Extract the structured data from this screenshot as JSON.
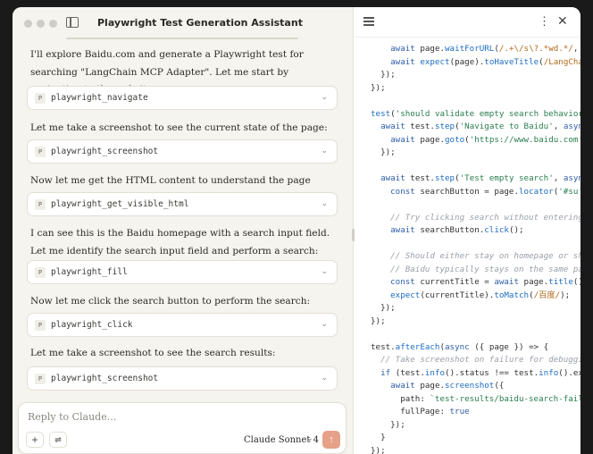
{
  "window": {
    "title": "Playwright Test Generation Assistant"
  },
  "messages": [
    {
      "text": "I'll explore Baidu.com and generate a Playwright test for searching \"LangChain MCP Adapter\". Let me start by navigating to the website."
    },
    {
      "tool": "playwright_navigate"
    },
    {
      "text": "Let me take a screenshot to see the current state of the page:"
    },
    {
      "tool": "playwright_screenshot"
    },
    {
      "text": "Now let me get the HTML content to understand the page structure:"
    },
    {
      "tool": "playwright_get_visible_html"
    },
    {
      "text": "I can see this is the Baidu homepage with a search input field. Let me identify the search input field and perform a search:"
    },
    {
      "tool": "playwright_fill"
    },
    {
      "text": "Now let me click the search button to perform the search:"
    },
    {
      "tool": "playwright_click"
    },
    {
      "text": "Let me take a screenshot to see the search results:"
    },
    {
      "tool": "playwright_screenshot"
    }
  ],
  "tool_badge": "P",
  "composer": {
    "placeholder": "Reply to Claude...",
    "model": "Claude Sonnet 4"
  },
  "code_lines": [
    [
      [
        "t-pl",
        "    "
      ],
      [
        "t-kw",
        "await"
      ],
      [
        "t-pl",
        " page."
      ],
      [
        "t-fn",
        "waitForURL"
      ],
      [
        "t-pl",
        "("
      ],
      [
        "t-rx",
        "/.+\\/s\\?.*wd.*/"
      ],
      [
        "t-pl",
        ", { t"
      ]
    ],
    [
      [
        "t-pl",
        "    "
      ],
      [
        "t-kw",
        "await"
      ],
      [
        "t-pl",
        " "
      ],
      [
        "t-fn",
        "expect"
      ],
      [
        "t-pl",
        "(page)."
      ],
      [
        "t-fn",
        "toHaveTitle"
      ],
      [
        "t-pl",
        "("
      ],
      [
        "t-rx",
        "/LangChain"
      ]
    ],
    [
      [
        "t-pl",
        "  });"
      ]
    ],
    [
      [
        "t-pl",
        "});"
      ]
    ],
    [
      [
        "t-pl",
        ""
      ]
    ],
    [
      [
        "t-fn",
        "test"
      ],
      [
        "t-pl",
        "("
      ],
      [
        "t-st",
        "'should validate empty search behavior'"
      ],
      [
        "t-pl",
        ","
      ]
    ],
    [
      [
        "t-pl",
        "  "
      ],
      [
        "t-kw",
        "await"
      ],
      [
        "t-pl",
        " test."
      ],
      [
        "t-fn",
        "step"
      ],
      [
        "t-pl",
        "("
      ],
      [
        "t-st",
        "'Navigate to Baidu'"
      ],
      [
        "t-pl",
        ", "
      ],
      [
        "t-kw",
        "async"
      ],
      [
        "t-pl",
        " ("
      ]
    ],
    [
      [
        "t-pl",
        "    "
      ],
      [
        "t-kw",
        "await"
      ],
      [
        "t-pl",
        " page."
      ],
      [
        "t-fn",
        "goto"
      ],
      [
        "t-pl",
        "("
      ],
      [
        "t-st",
        "'https://www.baidu.com'"
      ],
      [
        "t-pl",
        ");"
      ]
    ],
    [
      [
        "t-pl",
        "  });"
      ]
    ],
    [
      [
        "t-pl",
        ""
      ]
    ],
    [
      [
        "t-pl",
        "  "
      ],
      [
        "t-kw",
        "await"
      ],
      [
        "t-pl",
        " test."
      ],
      [
        "t-fn",
        "step"
      ],
      [
        "t-pl",
        "("
      ],
      [
        "t-st",
        "'Test empty search'"
      ],
      [
        "t-pl",
        ", "
      ],
      [
        "t-kw",
        "async"
      ],
      [
        "t-pl",
        " ("
      ]
    ],
    [
      [
        "t-pl",
        "    "
      ],
      [
        "t-kw",
        "const"
      ],
      [
        "t-pl",
        " searchButton = page."
      ],
      [
        "t-fn",
        "locator"
      ],
      [
        "t-pl",
        "("
      ],
      [
        "t-st",
        "'#su'"
      ],
      [
        "t-pl",
        ");"
      ]
    ],
    [
      [
        "t-pl",
        ""
      ]
    ],
    [
      [
        "t-cm",
        "    // Try clicking search without entering a"
      ]
    ],
    [
      [
        "t-pl",
        "    "
      ],
      [
        "t-kw",
        "await"
      ],
      [
        "t-pl",
        " searchButton."
      ],
      [
        "t-fn",
        "click"
      ],
      [
        "t-pl",
        "();"
      ]
    ],
    [
      [
        "t-pl",
        ""
      ]
    ],
    [
      [
        "t-cm",
        "    // Should either stay on homepage or show"
      ]
    ],
    [
      [
        "t-cm",
        "    // Baidu typically stays on the same page"
      ]
    ],
    [
      [
        "t-pl",
        "    "
      ],
      [
        "t-kw",
        "const"
      ],
      [
        "t-pl",
        " currentTitle = "
      ],
      [
        "t-kw",
        "await"
      ],
      [
        "t-pl",
        " page."
      ],
      [
        "t-fn",
        "title"
      ],
      [
        "t-pl",
        "();"
      ]
    ],
    [
      [
        "t-pl",
        "    "
      ],
      [
        "t-fn",
        "expect"
      ],
      [
        "t-pl",
        "(currentTitle)."
      ],
      [
        "t-fn",
        "toMatch"
      ],
      [
        "t-pl",
        "("
      ],
      [
        "t-rx",
        "/百度/"
      ],
      [
        "t-pl",
        ");"
      ]
    ],
    [
      [
        "t-pl",
        "  });"
      ]
    ],
    [
      [
        "t-pl",
        "});"
      ]
    ],
    [
      [
        "t-pl",
        ""
      ]
    ],
    [
      [
        "t-pl",
        "test."
      ],
      [
        "t-fn",
        "afterEach"
      ],
      [
        "t-pl",
        "("
      ],
      [
        "t-kw",
        "async"
      ],
      [
        "t-pl",
        " ({ page }) => {"
      ]
    ],
    [
      [
        "t-cm",
        "  // Take screenshot on failure for debugging"
      ]
    ],
    [
      [
        "t-pl",
        "  "
      ],
      [
        "t-kw",
        "if"
      ],
      [
        "t-pl",
        " (test."
      ],
      [
        "t-fn",
        "info"
      ],
      [
        "t-pl",
        "().status !== test."
      ],
      [
        "t-fn",
        "info"
      ],
      [
        "t-pl",
        "().expec"
      ]
    ],
    [
      [
        "t-pl",
        "    "
      ],
      [
        "t-kw",
        "await"
      ],
      [
        "t-pl",
        " page."
      ],
      [
        "t-fn",
        "screenshot"
      ],
      [
        "t-pl",
        "({"
      ]
    ],
    [
      [
        "t-pl",
        "      path: "
      ],
      [
        "t-st",
        "`test-results/baidu-search-failure"
      ]
    ],
    [
      [
        "t-pl",
        "      fullPage: "
      ],
      [
        "t-kw",
        "true"
      ]
    ],
    [
      [
        "t-pl",
        "    });"
      ]
    ],
    [
      [
        "t-pl",
        "  }"
      ]
    ],
    [
      [
        "t-pl",
        "});"
      ]
    ]
  ]
}
